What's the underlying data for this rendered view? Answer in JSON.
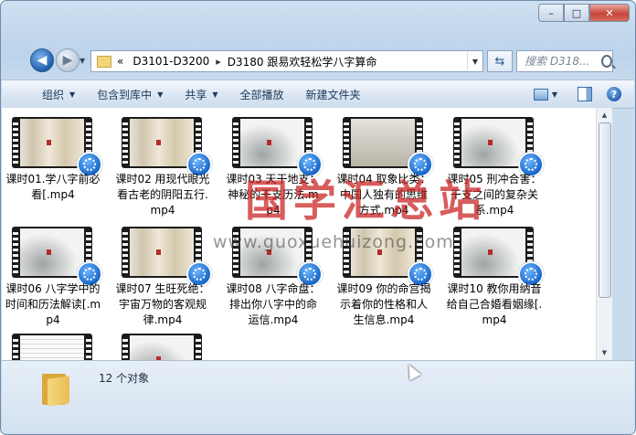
{
  "window": {
    "controls": {
      "minimize": "–",
      "maximize": "□",
      "close": "✕"
    }
  },
  "nav": {
    "back_glyph": "◀",
    "forward_glyph": "▶",
    "breadcrumb_lead": "«",
    "breadcrumbs": [
      "D3101-D3200",
      "D3180 跟易欢轻松学八字算命"
    ],
    "crumb_separator": "▸",
    "refresh_glyph": "⇆",
    "search_placeholder": "搜索 D318..."
  },
  "toolbar": {
    "organize": "组织",
    "include_in_library": "包含到库中",
    "share": "共享",
    "play_all": "全部播放",
    "new_folder": "新建文件夹"
  },
  "files": [
    {
      "name": "课时01.学八字前必看[.mp4",
      "thumb": "scroll"
    },
    {
      "name": "课时02 用现代眼光看古老的阴阳五行.mp4",
      "thumb": "scroll"
    },
    {
      "name": "课时03 天干地支：神秘的干支历法.mp4",
      "thumb": "ink"
    },
    {
      "name": "课时04 取象比类：中国人独有的思维方式.mp4",
      "thumb": "dark"
    },
    {
      "name": "课时05 刑冲合害：干支之间的复杂关系.mp4",
      "thumb": "ink"
    },
    {
      "name": "课时06 八字学中的时间和历法解读[.mp4",
      "thumb": "ink"
    },
    {
      "name": "课时07 生旺死绝：宇宙万物的客观规律.mp4",
      "thumb": "scroll"
    },
    {
      "name": "课时08 八字命盘：排出你八字中的命运信.mp4",
      "thumb": "ink"
    },
    {
      "name": "课时09 你的命宫揭示着你的性格和人生信息.mp4",
      "thumb": "scroll"
    },
    {
      "name": "课时10 教你用纳音给自己合婚看姻缘[.mp4",
      "thumb": "ink"
    },
    {
      "name": "",
      "thumb": "paper"
    },
    {
      "name": "",
      "thumb": "ink"
    }
  ],
  "watermark": {
    "text": "国学汇总站",
    "url": "www.guoxuehuizong.com"
  },
  "status": {
    "count": "12 个对象"
  }
}
